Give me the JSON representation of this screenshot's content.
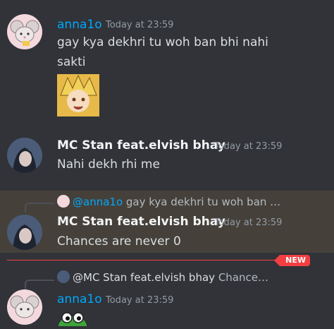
{
  "messages": [
    {
      "author": "anna1o",
      "timestamp": "Today at 23:59",
      "lines": [
        "gay kya dekhri tu woh ban bhi nahi",
        "sakti"
      ]
    },
    {
      "author": "MC Stan feat.elvish bhay",
      "timestamp": "Today at 23:59",
      "text": "Nahi dekh rhi me"
    },
    {
      "reply_author": "@anna1o",
      "reply_text": "gay kya dekhri tu woh ban bhi nahi sakti",
      "author": "MC Stan feat.elvish bhay",
      "timestamp": "Today at 23:59",
      "text": "Chances are never 0"
    },
    {
      "reply_author": "@MC Stan feat.elvish bhay",
      "reply_text": "Chances ...",
      "author": "anna1o",
      "timestamp": "Today at 23:59"
    }
  ],
  "new_badge": "NEW",
  "colors": {
    "background": "#313338",
    "highlight": "#45413a",
    "mention": "#00a8fc",
    "new": "#f23f42"
  },
  "icons": [
    "mouse-avatar",
    "anime-avatar",
    "anime-sticker",
    "frog-sticker"
  ]
}
